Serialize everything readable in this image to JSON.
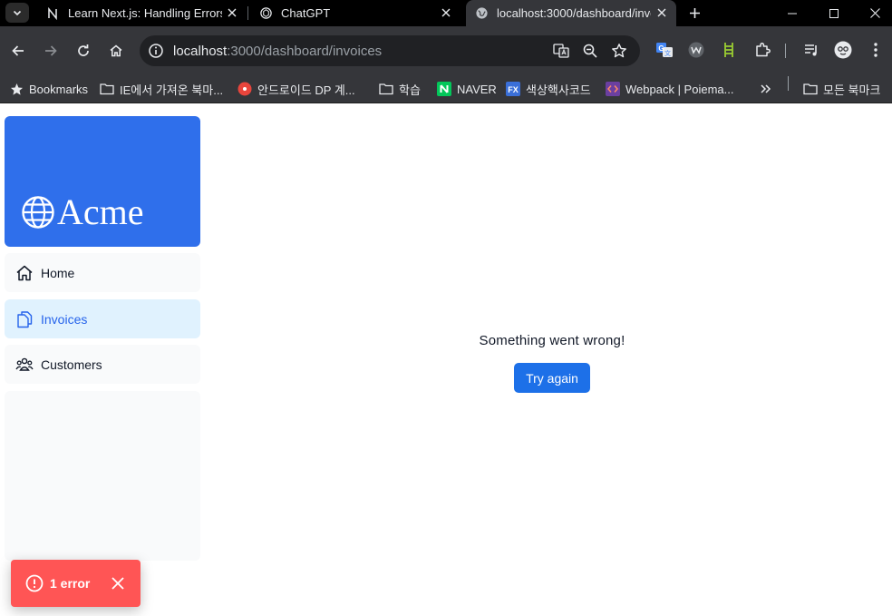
{
  "browser": {
    "tabs": [
      {
        "title": "Learn Next.js: Handling Errors",
        "favicon": "nextjs-icon"
      },
      {
        "title": "ChatGPT",
        "favicon": "chatgpt-icon"
      },
      {
        "title": "localhost:3000/dashboard/invo",
        "favicon": "globe-icon",
        "active": true
      }
    ],
    "address": {
      "host": "localhost",
      "path": ":3000/dashboard/invoices"
    },
    "bookmarks": [
      {
        "label": "Bookmarks",
        "icon": "star-icon"
      },
      {
        "label": "IE에서 가져온 북마...",
        "icon": "folder-icon"
      },
      {
        "label": "안드로이드 DP 계...",
        "icon": "red-circle-icon"
      },
      {
        "label": "학습",
        "icon": "folder-icon"
      },
      {
        "label": "NAVER",
        "icon": "naver-icon"
      },
      {
        "label": "색상핵사코드",
        "icon": "fx-icon"
      },
      {
        "label": "Webpack | Poiema...",
        "icon": "code-icon"
      },
      {
        "label": "모든 북마크",
        "icon": "folder-icon"
      }
    ]
  },
  "sidebar": {
    "brand": "Acme",
    "items": [
      {
        "label": "Home",
        "icon": "home-icon"
      },
      {
        "label": "Invoices",
        "icon": "document-icon",
        "active": true
      },
      {
        "label": "Customers",
        "icon": "users-icon"
      }
    ]
  },
  "main": {
    "error_message": "Something went wrong!",
    "retry_label": "Try again"
  },
  "dev_overlay": {
    "error_count_label": "1 error"
  },
  "colors": {
    "brand": "#2f6feb",
    "active_nav_bg": "#e0f2fe",
    "button": "#1d70e8",
    "toast": "#ff5555"
  }
}
